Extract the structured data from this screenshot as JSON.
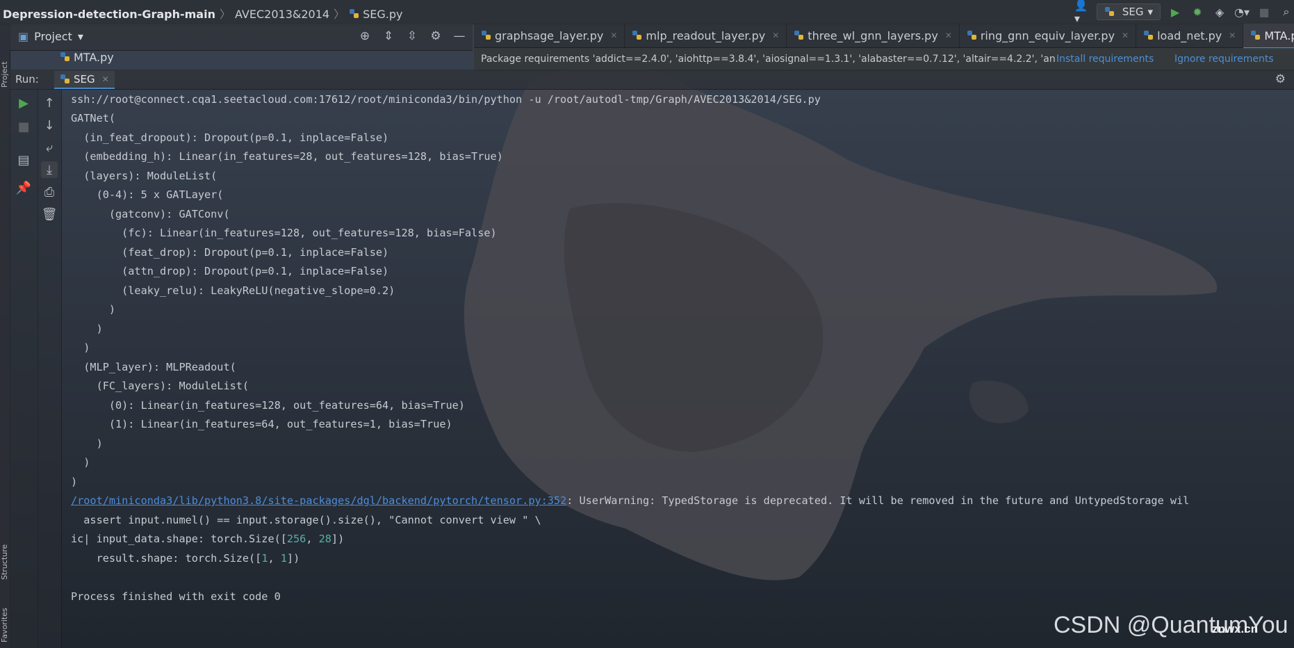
{
  "breadcrumb": {
    "project": "Depression-detection-Graph-main",
    "folder": "AVEC2013&2014",
    "file": "SEG.py"
  },
  "toolbar": {
    "run_config": "SEG"
  },
  "project_panel": {
    "title": "Project",
    "file": "MTA.py"
  },
  "left_stripe": {
    "top_label": "Project",
    "structure_label": "Structure",
    "favorites_label": "Favorites"
  },
  "tabs": [
    {
      "label": "graphsage_layer.py"
    },
    {
      "label": "mlp_readout_layer.py"
    },
    {
      "label": "three_wl_gnn_layers.py"
    },
    {
      "label": "ring_gnn_equiv_layer.py"
    },
    {
      "label": "load_net.py"
    },
    {
      "label": "MTA.py"
    }
  ],
  "notification": {
    "message": "Package requirements 'addict==2.4.0', 'aiohttp==3.8.4', 'aiosignal==1.3.1', 'alabaster==0.7.12', 'altair==4.2.2', 'an",
    "install": "Install requirements",
    "ignore": "Ignore requirements"
  },
  "run": {
    "label": "Run:",
    "tab": "SEG"
  },
  "console": {
    "lines": [
      "ssh://root@connect.cqa1.seetacloud.com:17612/root/miniconda3/bin/python -u /root/autodl-tmp/Graph/AVEC2013&2014/SEG.py",
      "GATNet(",
      "  (in_feat_dropout): Dropout(p=0.1, inplace=False)",
      "  (embedding_h): Linear(in_features=28, out_features=128, bias=True)",
      "  (layers): ModuleList(",
      "    (0-4): 5 x GATLayer(",
      "      (gatconv): GATConv(",
      "        (fc): Linear(in_features=128, out_features=128, bias=False)",
      "        (feat_drop): Dropout(p=0.1, inplace=False)",
      "        (attn_drop): Dropout(p=0.1, inplace=False)",
      "        (leaky_relu): LeakyReLU(negative_slope=0.2)",
      "      )",
      "    )",
      "  )",
      "  (MLP_layer): MLPReadout(",
      "    (FC_layers): ModuleList(",
      "      (0): Linear(in_features=128, out_features=64, bias=True)",
      "      (1): Linear(in_features=64, out_features=1, bias=True)",
      "    )",
      "  )",
      ")"
    ],
    "warning_link": "/root/miniconda3/lib/python3.8/site-packages/dgl/backend/pytorch/tensor.py:352",
    "warning_text": ": UserWarning: TypedStorage is deprecated. It will be removed in the future and UntypedStorage wil",
    "assert_line": "  assert input.numel() == input.storage().size(), \"Cannot convert view \" \\",
    "ic_prefix": "ic| input_data.shape: torch.Size([",
    "ic_n1": "256",
    "ic_sep": ", ",
    "ic_n2": "28",
    "ic_suffix": "])",
    "result_prefix": "    result.shape: torch.Size([",
    "result_n1": "1",
    "result_sep": ", ",
    "result_n2": "1",
    "result_suffix": "])",
    "finish": "Process finished with exit code 0"
  },
  "watermark": {
    "text": "CSDN @QuantumYou",
    "site": "znwx.cn"
  },
  "colors": {
    "accent": "#4a88c7",
    "link": "#4c8dd8",
    "run_green": "#4fa84f"
  }
}
